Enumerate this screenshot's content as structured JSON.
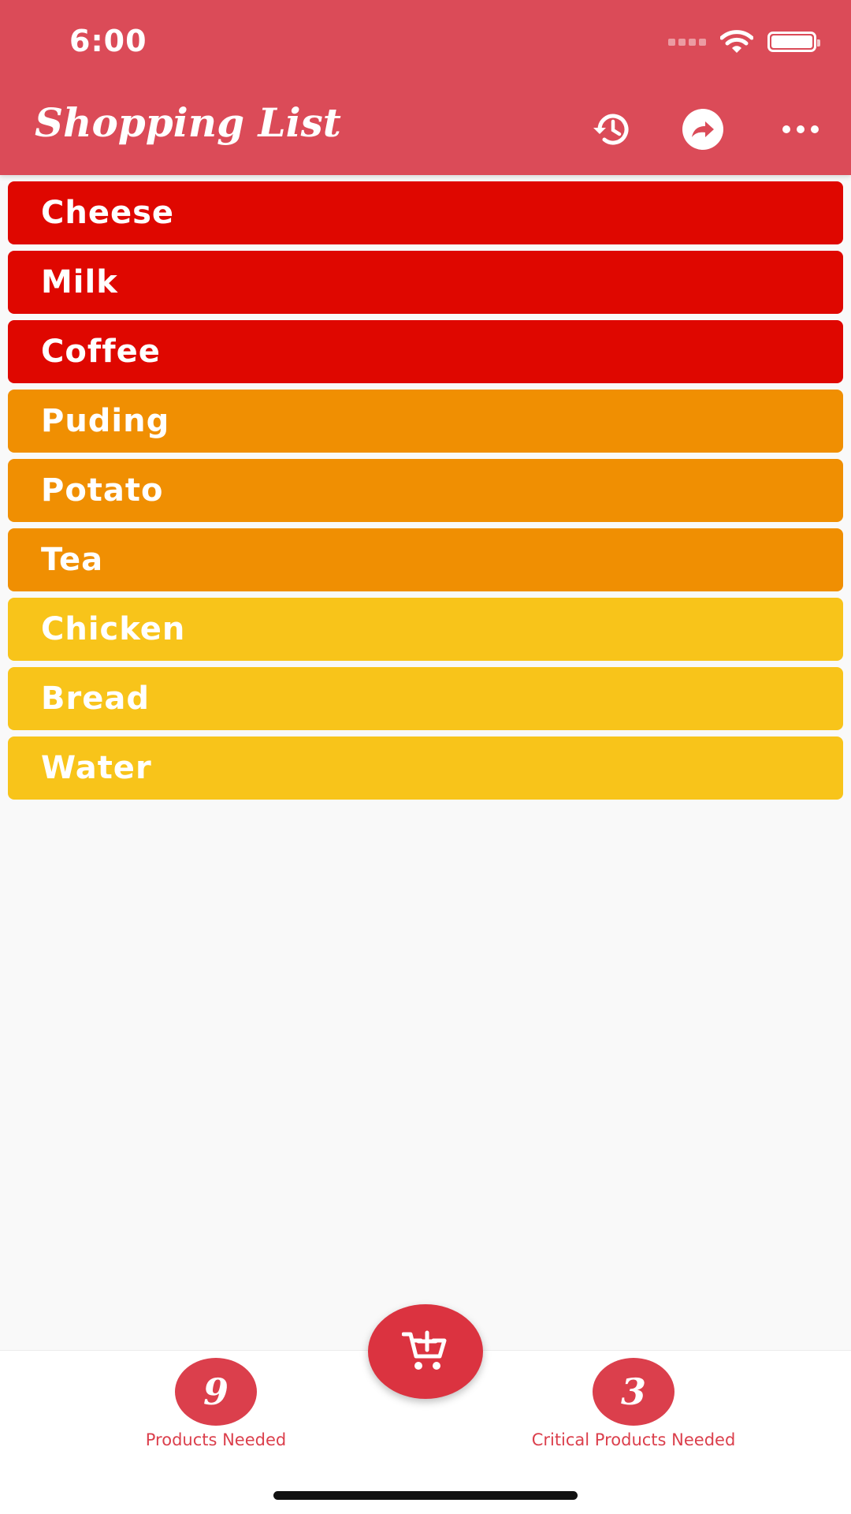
{
  "status_bar": {
    "time": "6:00"
  },
  "app_bar": {
    "title": "Shopping List",
    "actions": [
      {
        "icon": "history-icon"
      },
      {
        "icon": "share-icon"
      },
      {
        "icon": "more-icon"
      }
    ]
  },
  "colors": {
    "app_bar": "#db4b58",
    "critical": "#df0700",
    "high": "#f08f02",
    "medium": "#f8c41a",
    "accent": "#db3f4c"
  },
  "items": [
    {
      "name": "Cheese",
      "priority": "critical"
    },
    {
      "name": "Milk",
      "priority": "critical"
    },
    {
      "name": "Coffee",
      "priority": "critical"
    },
    {
      "name": "Puding",
      "priority": "high"
    },
    {
      "name": "Potato",
      "priority": "high"
    },
    {
      "name": "Tea",
      "priority": "high"
    },
    {
      "name": "Chicken",
      "priority": "medium"
    },
    {
      "name": "Bread",
      "priority": "medium"
    },
    {
      "name": "Water",
      "priority": "medium"
    }
  ],
  "bottom": {
    "products_needed": {
      "count": "9",
      "label": "Products Needed"
    },
    "critical_needed": {
      "count": "3",
      "label": "Critical Products Needed"
    },
    "fab_icon": "add-to-cart-icon"
  }
}
